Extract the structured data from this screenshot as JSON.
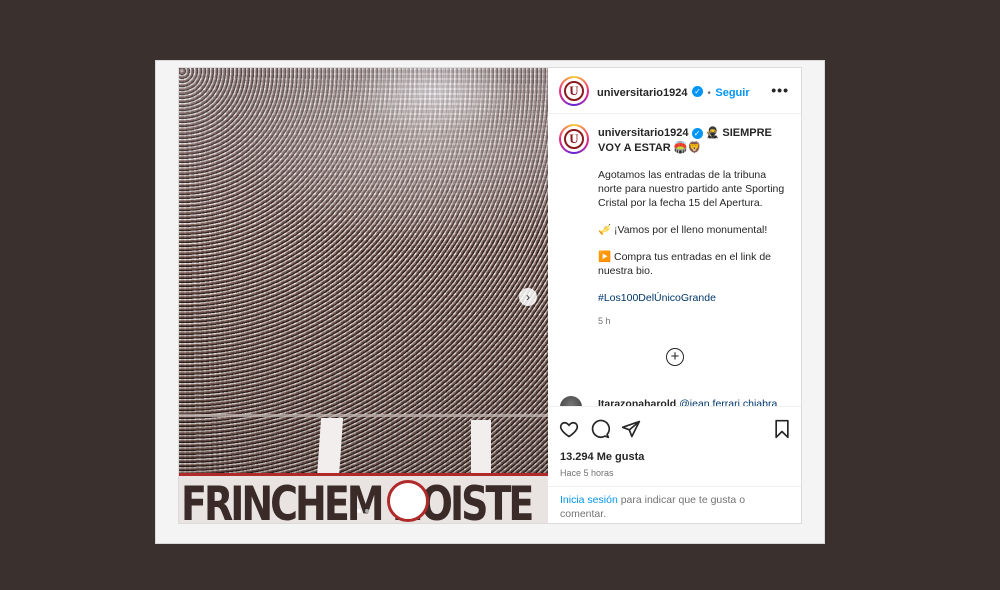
{
  "post": {
    "username": "universitario1924",
    "follow_label": "Seguir",
    "separator": "•",
    "more_label": "•••",
    "caption_title": "🥷 SIEMPRE VOY A ESTAR 🏟️🦁",
    "caption_paragraphs": [
      "Agotamos las entradas de la tribuna norte para nuestro partido ante Sporting Cristal por la fecha 15 del Apertura.",
      "🎺 ¡Vamos por el lleno monumental!",
      "▶️ Compra tus entradas en el link de nuestra bio."
    ],
    "hashtag": "#Los100DelÚnicoGrande",
    "caption_time": "5 h",
    "comment_user": "Itarazonaharold",
    "comment_mention": "@jean.ferrari.chiabra",
    "likes": "13.294 Me gusta",
    "posted_ago": "Hace 5 horas",
    "login_link": "Inicia sesión",
    "login_rest": " para indicar que te gusta o comentar.",
    "banner_text": "FRINCHEM NOISTE",
    "logo_letter": "U"
  },
  "carousel": {
    "current_slide": 1,
    "total_slides": 2
  },
  "icons": [
    "verified-icon",
    "more-icon",
    "heart-icon",
    "comment-icon",
    "share-icon",
    "bookmark-icon",
    "add-comment-icon",
    "next-arrow-icon"
  ],
  "colors": {
    "accent": "#0095f6",
    "background": "#3a302d",
    "brand": "#8c1c1c"
  }
}
